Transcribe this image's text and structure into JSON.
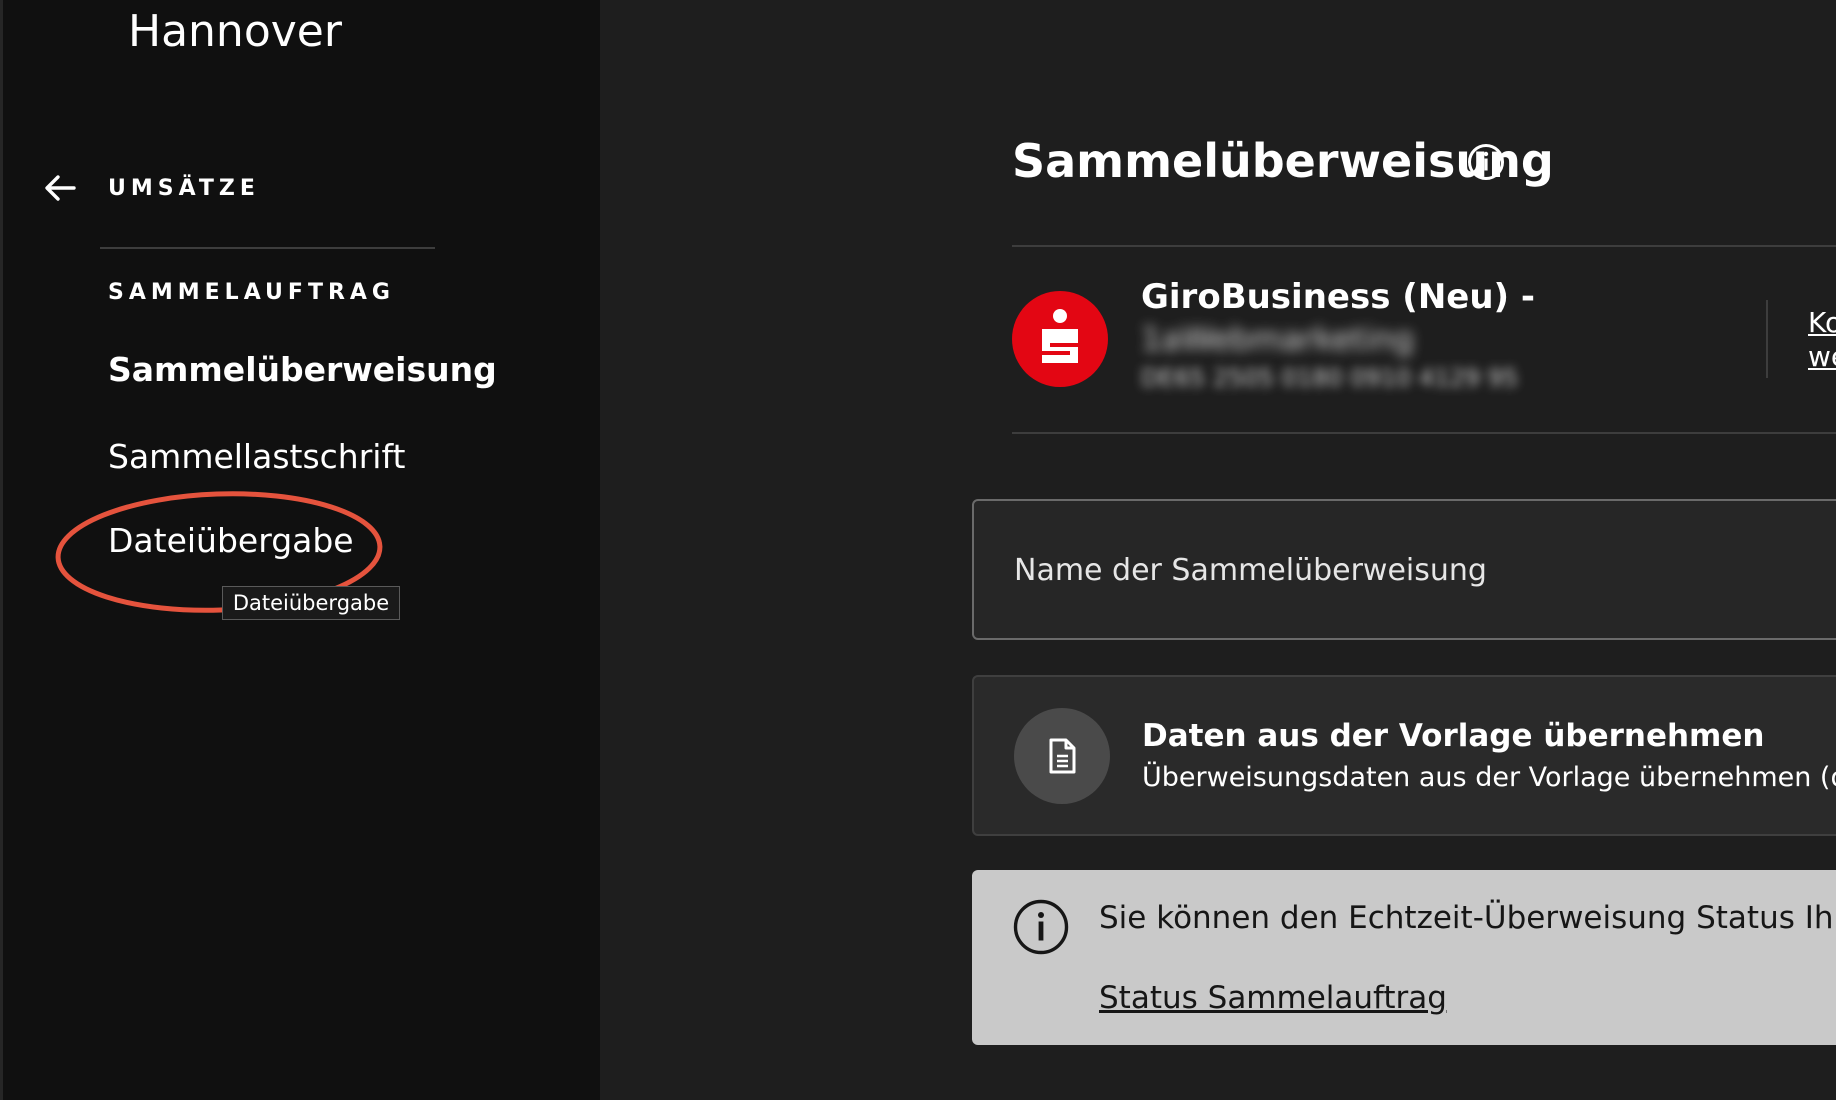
{
  "sidebar": {
    "bank_title": "Hannover",
    "back_label": "UMSÄTZE",
    "section_label": "SAMMELAUFTRAG",
    "items": [
      {
        "label": "Sammelüberweisung",
        "active": true
      },
      {
        "label": "Sammellastschrift",
        "active": false
      },
      {
        "label": "Dateiübergabe",
        "active": false
      }
    ],
    "tooltip": "Dateiübergabe",
    "highlight_color": "#e5533d"
  },
  "main": {
    "title": "Sammelüberweisung",
    "account": {
      "name": "GiroBusiness (Neu) -",
      "holder": "1aWebmarketing",
      "iban": "DE65 2505 0180 0910 4129 95",
      "change_link": "Ko\nwe"
    },
    "name_field": {
      "placeholder": "Name der Sammelüberweisung",
      "value": ""
    },
    "template": {
      "title": "Daten aus der Vorlage übernehmen",
      "subtitle": "Überweisungsdaten aus der Vorlage übernehmen (optic"
    },
    "info": {
      "text": "Sie können den Echtzeit-Überweisung Status Ihrer v",
      "link": "Status Sammelauftrag"
    },
    "colors": {
      "brand_red": "#e30613",
      "background": "#1e1e1e",
      "sidebar": "#101010",
      "info_box": "#c9c9c9"
    }
  }
}
